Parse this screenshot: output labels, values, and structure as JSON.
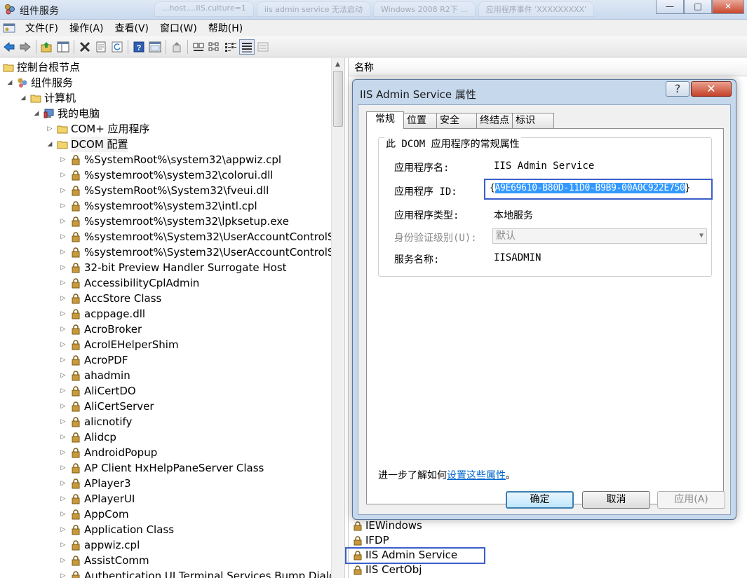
{
  "window": {
    "title": "组件服务",
    "background_tabs": [
      "...host....IIS.culture=1",
      "iis admin service 无法启动",
      "Windows 2008 R2下 ...",
      "应用程序事件 'XXXXXXXXX'"
    ]
  },
  "menu": [
    "文件(F)",
    "操作(A)",
    "查看(V)",
    "窗口(W)",
    "帮助(H)"
  ],
  "toolbar": [
    "back-icon",
    "forward-icon",
    "up-folder-icon",
    "show-tree-icon",
    "delete-icon",
    "properties-icon",
    "refresh-icon",
    "help-icon",
    "console-icon",
    "export-icon",
    "large-icons-icon",
    "small-icons-icon",
    "list-view-icon",
    "detail-view-icon",
    "status-view-icon"
  ],
  "tree": {
    "root": "控制台根节点",
    "component_services": "组件服务",
    "computers": "计算机",
    "my_computer": "我的电脑",
    "com_plus": "COM+ 应用程序",
    "dcom": "DCOM 配置",
    "items": [
      "%SystemRoot%\\system32\\appwiz.cpl",
      "%systemroot%\\system32\\colorui.dll",
      "%SystemRoot%\\System32\\fveui.dll",
      "%systemroot%\\system32\\intl.cpl",
      "%systemroot%\\system32\\lpksetup.exe",
      "%systemroot%\\System32\\UserAccountControlS",
      "%systemroot%\\System32\\UserAccountControlS",
      "32-bit Preview Handler Surrogate Host",
      "AccessibilityCplAdmin",
      "AccStore Class",
      "acppage.dll",
      "AcroBroker",
      "AcroIEHelperShim",
      "AcroPDF",
      "ahadmin",
      "AliCertDO",
      "AliCertServer",
      "alicnotify",
      "Alidcp",
      "AndroidPopup",
      "AP Client HxHelpPaneServer Class",
      "APlayer3",
      "APlayerUI",
      "AppCom",
      "Application Class",
      "appwiz.cpl",
      "AssistComm",
      "Authentication UI Terminal Services Bump Dialog"
    ]
  },
  "list": {
    "column_name": "名称",
    "items": [
      "IEWindows",
      "IFDP",
      "IIS Admin Service",
      "IIS CertObj"
    ],
    "selected": "IIS Admin Service"
  },
  "dialog": {
    "title": "IIS Admin Service 属性",
    "help_label": "?",
    "close_label": "✕",
    "tabs": [
      "常规",
      "位置",
      "安全",
      "终结点",
      "标识"
    ],
    "group_title": "此 DCOM 应用程序的常规属性",
    "app_name_label": "应用程序名:",
    "app_name_value": "IIS Admin Service",
    "app_id_label": "应用程序 ID:",
    "app_id_open": "{",
    "app_id_value": "A9E69610-B80D-11D0-B9B9-00A0C922E750",
    "app_id_close": "}",
    "app_type_label": "应用程序类型:",
    "app_type_value": "本地服务",
    "auth_level_label": "身份验证级别(U):",
    "auth_level_value": "默认",
    "service_name_label": "服务名称:",
    "service_name_value": "IISADMIN",
    "learn_more_prefix": "进一步了解如何",
    "learn_more_link": "设置这些属性",
    "learn_more_suffix": "。",
    "ok_label": "确定",
    "cancel_label": "取消",
    "apply_label": "应用(A)"
  },
  "colors": {
    "highlight_border": "#3b5fc9",
    "selection": "#3399ff",
    "link": "#0066cc",
    "lock_icon": "#c89a3c"
  }
}
